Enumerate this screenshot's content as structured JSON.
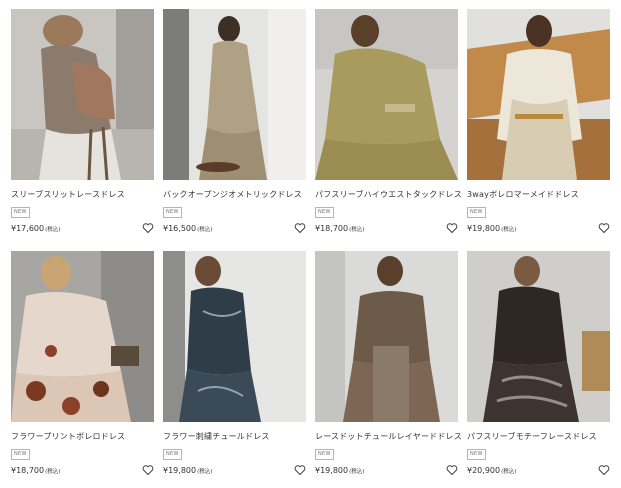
{
  "products": [
    {
      "name": "スリーブスリットレースドレス",
      "badge": "NEW",
      "price": "¥17,600",
      "tax": "(税込)",
      "fav_icon": "heart-outline-icon"
    },
    {
      "name": "バックオープンジオメトリックドレス",
      "badge": "NEW",
      "price": "¥16,500",
      "tax": "(税込)",
      "fav_icon": "heart-outline-icon"
    },
    {
      "name": "パフスリーブハイウエストタックドレス",
      "badge": "NEW",
      "price": "¥18,700",
      "tax": "(税込)",
      "fav_icon": "heart-outline-icon"
    },
    {
      "name": "3wayボレロマーメイドドレス",
      "badge": "NEW",
      "price": "¥19,800",
      "tax": "(税込)",
      "fav_icon": "heart-outline-icon"
    },
    {
      "name": "フラワープリントボレロドレス",
      "badge": "NEW",
      "price": "¥18,700",
      "tax": "(税込)",
      "fav_icon": "heart-outline-icon"
    },
    {
      "name": "フラワー刺繍チュールドレス",
      "badge": "NEW",
      "price": "¥19,800",
      "tax": "(税込)",
      "fav_icon": "heart-outline-icon"
    },
    {
      "name": "レースドットチュールレイヤードドレス",
      "badge": "NEW",
      "price": "¥19,800",
      "tax": "(税込)",
      "fav_icon": "heart-outline-icon"
    },
    {
      "name": "パフスリーブモチーフレースドレス",
      "badge": "NEW",
      "price": "¥20,900",
      "tax": "(税込)",
      "fav_icon": "heart-outline-icon"
    }
  ],
  "colors": {
    "text": "#333333",
    "badge_border": "#b5b5b5",
    "badge_text": "#777777"
  }
}
